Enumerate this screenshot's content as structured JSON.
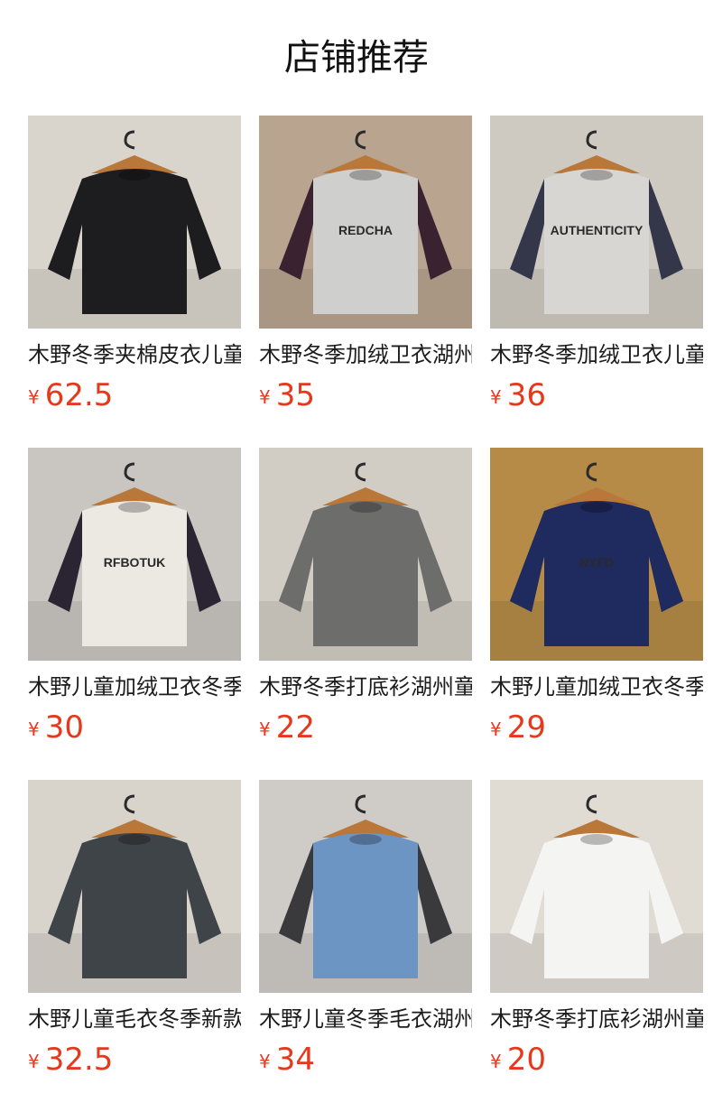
{
  "header": {
    "title": "店铺推荐"
  },
  "products": [
    {
      "name": "木野冬季夹棉皮衣儿童",
      "currency": "¥",
      "price": "62.5",
      "image": "black-leather-jacket-photo",
      "bg": "#d9d5cc",
      "garment": "#1d1d1f",
      "sleeve": "#1d1d1f",
      "logo": ""
    },
    {
      "name": "木野冬季加绒卫衣湖州",
      "currency": "¥",
      "price": "35",
      "image": "grey-raglan-sweatshirt-photo",
      "bg": "#b9a48f",
      "garment": "#cfcfcd",
      "sleeve": "#3b2230",
      "logo": "REDCHA"
    },
    {
      "name": "木野冬季加绒卫衣儿童",
      "currency": "¥",
      "price": "36",
      "image": "plaid-sleeve-sweatshirt-photo",
      "bg": "#cfcac1",
      "garment": "#d7d6d3",
      "sleeve": "#34364a",
      "logo": "AUTHENTICITY"
    },
    {
      "name": "木野儿童加绒卫衣冬季",
      "currency": "¥",
      "price": "30",
      "image": "robot-print-sweatshirt-photo",
      "bg": "#c9c6c1",
      "garment": "#ece9e2",
      "sleeve": "#2a2433",
      "logo": "RFBOTUK"
    },
    {
      "name": "木野冬季打底衫湖州童",
      "currency": "¥",
      "price": "22",
      "image": "grey-layered-tee-photo",
      "bg": "#d2cdc4",
      "garment": "#6d6e6c",
      "sleeve": "#6d6e6c",
      "logo": ""
    },
    {
      "name": "木野儿童加绒卫衣冬季",
      "currency": "¥",
      "price": "29",
      "image": "navy-sweatshirts-rack-photo",
      "bg": "#b58b47",
      "garment": "#1f2a5e",
      "sleeve": "#1f2a5e",
      "logo": "NYFD"
    },
    {
      "name": "木野儿童毛衣冬季新款",
      "currency": "¥",
      "price": "32.5",
      "image": "dark-knit-sweater-photo",
      "bg": "#d8d3cb",
      "garment": "#3f4449",
      "sleeve": "#3f4449",
      "logo": ""
    },
    {
      "name": "木野儿童冬季毛衣湖州",
      "currency": "¥",
      "price": "34",
      "image": "blue-knit-sweater-photo",
      "bg": "#cfcbc6",
      "garment": "#6c95c4",
      "sleeve": "#3a3a3c",
      "logo": ""
    },
    {
      "name": "木野冬季打底衫湖州童",
      "currency": "¥",
      "price": "20",
      "image": "white-mickey-tee-photo",
      "bg": "#e0dcd4",
      "garment": "#f4f4f2",
      "sleeve": "#f4f4f2",
      "logo": ""
    }
  ]
}
